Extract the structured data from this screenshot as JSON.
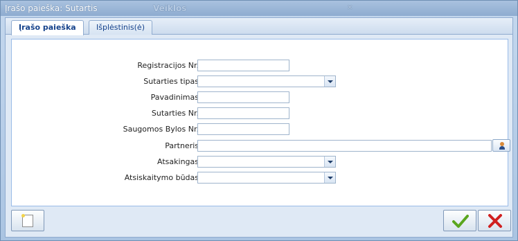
{
  "window": {
    "title": "Įrašo paieška: Sutartis",
    "ghost_title": "Veiklos",
    "ghost_btn": "✕"
  },
  "tabs": [
    {
      "label": "Įrašo paieška",
      "active": true
    },
    {
      "label": "Išplėstinis(ė)",
      "active": false
    }
  ],
  "form": {
    "fields": [
      {
        "label": "Registracijos Nr.",
        "type": "text",
        "value": ""
      },
      {
        "label": "Sutarties tipas",
        "type": "select",
        "value": ""
      },
      {
        "label": "Pavadinimas",
        "type": "text",
        "value": ""
      },
      {
        "label": "Sutarties Nr.",
        "type": "text",
        "value": ""
      },
      {
        "label": "Saugomos Bylos Nr.",
        "type": "text",
        "value": ""
      },
      {
        "label": "Partneris",
        "type": "lookup",
        "value": ""
      },
      {
        "label": "Atsakingas",
        "type": "select",
        "value": ""
      },
      {
        "label": "Atsiskaitymo būdas",
        "type": "select",
        "value": ""
      }
    ]
  },
  "icons": {
    "new": "new-document-icon",
    "ok": "check-icon",
    "cancel": "close-icon",
    "lookup": "person-icon"
  },
  "colors": {
    "ok": "#5aa61e",
    "cancel": "#d02020",
    "accent": "#15428b"
  }
}
